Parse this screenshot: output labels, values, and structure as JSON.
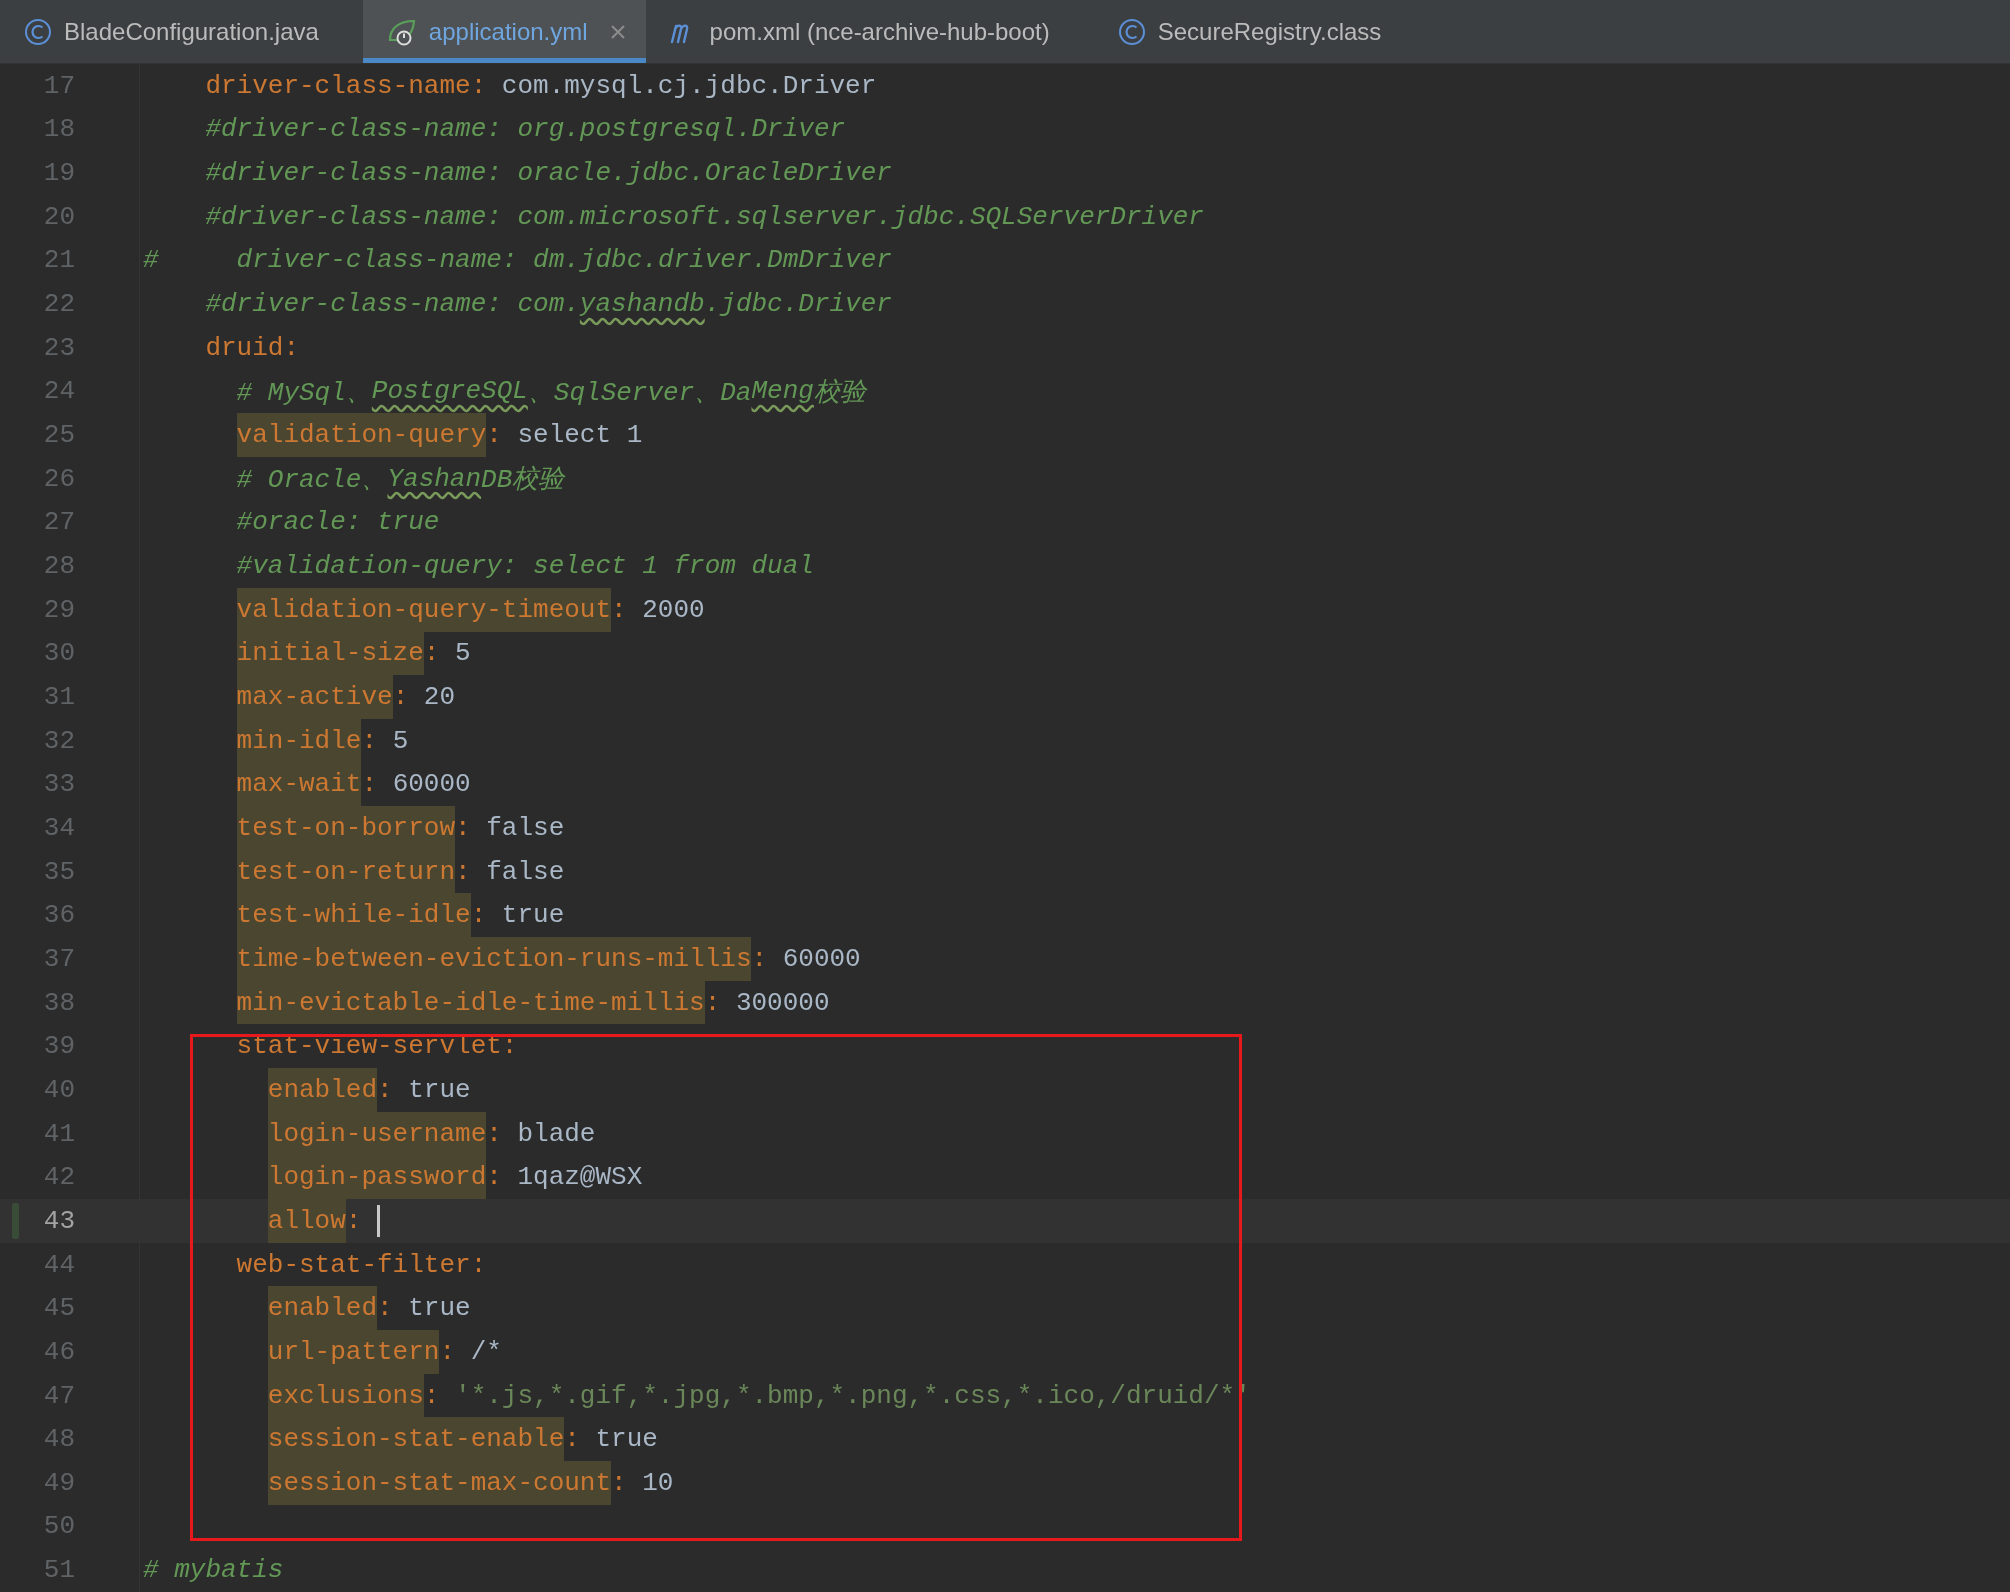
{
  "tabs": [
    {
      "label": "BladeConfiguration.java",
      "kind": "class",
      "selected": false
    },
    {
      "label": "application.yml",
      "kind": "yaml",
      "selected": true
    },
    {
      "label": "pom.xml (nce-archive-hub-boot)",
      "kind": "maven",
      "selected": false
    },
    {
      "label": "SecureRegistry.class",
      "kind": "class",
      "selected": false
    }
  ],
  "editor": {
    "lines": [
      {
        "kind": "group",
        "children": [
          {
            "kind": "group",
            "children": [
              {
                "kind": "line",
                "number": "17",
                "current": false,
                "modified": false,
                "tokens": [
                  {
                    "kind": "key",
                    "text": "driver-class-name",
                    "highlighted": false
                  },
                  {
                    "kind": "colon",
                    "text": ":"
                  },
                  {
                    "kind": "value",
                    "text": "com.mysql.cj.jdbc.Driver"
                  }
                ]
              },
              {
                "kind": "line",
                "number": "18",
                "current": false,
                "modified": false,
                "tokens": [
                  {
                    "kind": "comment",
                    "text": "#driver-class-name: org.postgresql.Driver",
                    "misspelled": false
                  }
                ]
              },
              {
                "kind": "line",
                "number": "19",
                "current": false,
                "modified": false,
                "tokens": [
                  {
                    "kind": "comment",
                    "text": "#driver-class-name: oracle.jdbc.OracleDriver",
                    "misspelled": false
                  }
                ]
              },
              {
                "kind": "line",
                "number": "20",
                "current": false,
                "modified": false,
                "tokens": [
                  {
                    "kind": "comment",
                    "text": "#driver-class-name: com.microsoft.sqlserver.jdbc.SQLServerDriver",
                    "misspelled": false
                  }
                ]
              }
            ]
          }
        ]
      },
      {
        "kind": "line",
        "number": "21",
        "current": false,
        "modified": false,
        "tokens": [
          {
            "kind": "comment",
            "text": "#     driver-class-name: dm.jdbc.driver.DmDriver",
            "misspelled": false
          }
        ]
      },
      {
        "kind": "group",
        "children": [
          {
            "kind": "group",
            "children": [
              {
                "kind": "line",
                "number": "22",
                "current": false,
                "modified": false,
                "tokens": [
                  {
                    "kind": "comment",
                    "text": "#driver-class-name: com.",
                    "misspelled": false
                  },
                  {
                    "kind": "comment",
                    "text": "yashandb",
                    "misspelled": true
                  },
                  {
                    "kind": "comment",
                    "text": ".jdbc.Driver",
                    "misspelled": false
                  }
                ]
              },
              {
                "kind": "line",
                "number": "23",
                "current": false,
                "modified": false,
                "tokens": [
                  {
                    "kind": "key",
                    "text": "druid",
                    "highlighted": false
                  },
                  {
                    "kind": "colon",
                    "text": ":"
                  }
                ],
                "children": [
                  {
                    "kind": "line",
                    "number": "24",
                    "current": false,
                    "modified": false,
                    "tokens": [
                      {
                        "kind": "comment",
                        "text": "# MySql、",
                        "misspelled": false
                      },
                      {
                        "kind": "comment",
                        "text": "PostgreSQL",
                        "misspelled": true
                      },
                      {
                        "kind": "comment",
                        "text": "、SqlServer、Da",
                        "misspelled": false
                      },
                      {
                        "kind": "comment",
                        "text": "Meng",
                        "misspelled": true
                      },
                      {
                        "kind": "comment",
                        "text": "校验",
                        "misspelled": false
                      }
                    ]
                  },
                  {
                    "kind": "line",
                    "number": "25",
                    "current": false,
                    "modified": false,
                    "tokens": [
                      {
                        "kind": "key",
                        "text": "validation-query",
                        "highlighted": true
                      },
                      {
                        "kind": "colon",
                        "text": ":"
                      },
                      {
                        "kind": "value",
                        "text": "select 1"
                      }
                    ]
                  },
                  {
                    "kind": "line",
                    "number": "26",
                    "current": false,
                    "modified": false,
                    "tokens": [
                      {
                        "kind": "comment",
                        "text": "# Oracle、",
                        "misspelled": false
                      },
                      {
                        "kind": "comment",
                        "text": "Yashan",
                        "misspelled": true
                      },
                      {
                        "kind": "comment",
                        "text": "DB校验",
                        "misspelled": false
                      }
                    ]
                  },
                  {
                    "kind": "line",
                    "number": "27",
                    "current": false,
                    "modified": false,
                    "tokens": [
                      {
                        "kind": "comment",
                        "text": "#oracle: true",
                        "misspelled": false
                      }
                    ]
                  },
                  {
                    "kind": "line",
                    "number": "28",
                    "current": false,
                    "modified": false,
                    "tokens": [
                      {
                        "kind": "comment",
                        "text": "#validation-query: select 1 from dual",
                        "misspelled": false
                      }
                    ]
                  },
                  {
                    "kind": "line",
                    "number": "29",
                    "current": false,
                    "modified": false,
                    "tokens": [
                      {
                        "kind": "key",
                        "text": "validation-query-timeout",
                        "highlighted": true
                      },
                      {
                        "kind": "colon",
                        "text": ":"
                      },
                      {
                        "kind": "value",
                        "text": "2000"
                      }
                    ]
                  },
                  {
                    "kind": "line",
                    "number": "30",
                    "current": false,
                    "modified": false,
                    "tokens": [
                      {
                        "kind": "key",
                        "text": "initial-size",
                        "highlighted": true
                      },
                      {
                        "kind": "colon",
                        "text": ":"
                      },
                      {
                        "kind": "value",
                        "text": "5"
                      }
                    ]
                  },
                  {
                    "kind": "line",
                    "number": "31",
                    "current": false,
                    "modified": false,
                    "tokens": [
                      {
                        "kind": "key",
                        "text": "max-active",
                        "highlighted": true
                      },
                      {
                        "kind": "colon",
                        "text": ":"
                      },
                      {
                        "kind": "value",
                        "text": "20"
                      }
                    ]
                  },
                  {
                    "kind": "line",
                    "number": "32",
                    "current": false,
                    "modified": false,
                    "tokens": [
                      {
                        "kind": "key",
                        "text": "min-idle",
                        "highlighted": true
                      },
                      {
                        "kind": "colon",
                        "text": ":"
                      },
                      {
                        "kind": "value",
                        "text": "5"
                      }
                    ]
                  },
                  {
                    "kind": "line",
                    "number": "33",
                    "current": false,
                    "modified": false,
                    "tokens": [
                      {
                        "kind": "key",
                        "text": "max-wait",
                        "highlighted": true
                      },
                      {
                        "kind": "colon",
                        "text": ":"
                      },
                      {
                        "kind": "value",
                        "text": "60000"
                      }
                    ]
                  },
                  {
                    "kind": "line",
                    "number": "34",
                    "current": false,
                    "modified": false,
                    "tokens": [
                      {
                        "kind": "key",
                        "text": "test-on-borrow",
                        "highlighted": true
                      },
                      {
                        "kind": "colon",
                        "text": ":"
                      },
                      {
                        "kind": "value",
                        "text": "false"
                      }
                    ]
                  },
                  {
                    "kind": "line",
                    "number": "35",
                    "current": false,
                    "modified": false,
                    "tokens": [
                      {
                        "kind": "key",
                        "text": "test-on-return",
                        "highlighted": true
                      },
                      {
                        "kind": "colon",
                        "text": ":"
                      },
                      {
                        "kind": "value",
                        "text": "false"
                      }
                    ]
                  },
                  {
                    "kind": "line",
                    "number": "36",
                    "current": false,
                    "modified": false,
                    "tokens": [
                      {
                        "kind": "key",
                        "text": "test-while-idle",
                        "highlighted": true
                      },
                      {
                        "kind": "colon",
                        "text": ":"
                      },
                      {
                        "kind": "value",
                        "text": "true"
                      }
                    ]
                  },
                  {
                    "kind": "line",
                    "number": "37",
                    "current": false,
                    "modified": false,
                    "tokens": [
                      {
                        "kind": "key",
                        "text": "time-between-eviction-runs-millis",
                        "highlighted": true
                      },
                      {
                        "kind": "colon",
                        "text": ":"
                      },
                      {
                        "kind": "value",
                        "text": "60000"
                      }
                    ]
                  },
                  {
                    "kind": "line",
                    "number": "38",
                    "current": false,
                    "modified": false,
                    "tokens": [
                      {
                        "kind": "key",
                        "text": "min-evictable-idle-time-millis",
                        "highlighted": true
                      },
                      {
                        "kind": "colon",
                        "text": ":"
                      },
                      {
                        "kind": "value",
                        "text": "300000"
                      }
                    ]
                  },
                  {
                    "kind": "annotation",
                    "children": [
                      {
                        "kind": "line",
                        "number": "39",
                        "current": false,
                        "modified": false,
                        "tokens": [
                          {
                            "kind": "key",
                            "text": "stat-view-servlet",
                            "highlighted": false
                          },
                          {
                            "kind": "colon",
                            "text": ":"
                          }
                        ],
                        "children": [
                          {
                            "kind": "line",
                            "number": "40",
                            "current": false,
                            "modified": false,
                            "tokens": [
                              {
                                "kind": "key",
                                "text": "enabled",
                                "highlighted": true
                              },
                              {
                                "kind": "colon",
                                "text": ":"
                              },
                              {
                                "kind": "value",
                                "text": "true"
                              }
                            ]
                          },
                          {
                            "kind": "line",
                            "number": "41",
                            "current": false,
                            "modified": false,
                            "tokens": [
                              {
                                "kind": "key",
                                "text": "login-username",
                                "highlighted": true
                              },
                              {
                                "kind": "colon",
                                "text": ":"
                              },
                              {
                                "kind": "value",
                                "text": "blade"
                              }
                            ]
                          },
                          {
                            "kind": "line",
                            "number": "42",
                            "current": false,
                            "modified": false,
                            "tokens": [
                              {
                                "kind": "key",
                                "text": "login-password",
                                "highlighted": true
                              },
                              {
                                "kind": "colon",
                                "text": ":"
                              },
                              {
                                "kind": "value",
                                "text": "1qaz@WSX"
                              }
                            ]
                          },
                          {
                            "kind": "line",
                            "number": "43",
                            "current": true,
                            "modified": true,
                            "tokens": [
                              {
                                "kind": "key",
                                "text": "allow",
                                "highlighted": true
                              },
                              {
                                "kind": "colon",
                                "text": ":"
                              }
                            ]
                          }
                        ]
                      },
                      {
                        "kind": "line",
                        "number": "44",
                        "current": false,
                        "modified": false,
                        "tokens": [
                          {
                            "kind": "key",
                            "text": "web-stat-filter",
                            "highlighted": false
                          },
                          {
                            "kind": "colon",
                            "text": ":"
                          }
                        ],
                        "children": [
                          {
                            "kind": "line",
                            "number": "45",
                            "current": false,
                            "modified": false,
                            "tokens": [
                              {
                                "kind": "key",
                                "text": "enabled",
                                "highlighted": true
                              },
                              {
                                "kind": "colon",
                                "text": ":"
                              },
                              {
                                "kind": "value",
                                "text": "true"
                              }
                            ]
                          },
                          {
                            "kind": "line",
                            "number": "46",
                            "current": false,
                            "modified": false,
                            "tokens": [
                              {
                                "kind": "key",
                                "text": "url-pattern",
                                "highlighted": true
                              },
                              {
                                "kind": "colon",
                                "text": ":"
                              },
                              {
                                "kind": "value",
                                "text": "/*"
                              }
                            ]
                          },
                          {
                            "kind": "line",
                            "number": "47",
                            "current": false,
                            "modified": false,
                            "tokens": [
                              {
                                "kind": "key",
                                "text": "exclusions",
                                "highlighted": true
                              },
                              {
                                "kind": "colon",
                                "text": ":"
                              },
                              {
                                "kind": "string",
                                "text": "'*.js,*.gif,*.jpg,*.bmp,*.png,*.css,*.ico,/druid/*'"
                              }
                            ]
                          },
                          {
                            "kind": "line",
                            "number": "48",
                            "current": false,
                            "modified": false,
                            "tokens": [
                              {
                                "kind": "key",
                                "text": "session-stat-enable",
                                "highlighted": true
                              },
                              {
                                "kind": "colon",
                                "text": ":"
                              },
                              {
                                "kind": "value",
                                "text": "true"
                              }
                            ]
                          },
                          {
                            "kind": "line",
                            "number": "49",
                            "current": false,
                            "modified": false,
                            "tokens": [
                              {
                                "kind": "key",
                                "text": "session-stat-max-count",
                                "highlighted": true
                              },
                              {
                                "kind": "colon",
                                "text": ":"
                              },
                              {
                                "kind": "value",
                                "text": "10"
                              }
                            ]
                          }
                        ]
                      },
                      {
                        "kind": "line",
                        "number": "50",
                        "current": false,
                        "modified": false
                      }
                    ]
                  }
                ]
              }
            ]
          }
        ]
      },
      {
        "kind": "line",
        "number": "51",
        "current": false,
        "modified": false,
        "tokens": [
          {
            "kind": "comment",
            "text": "# mybatis",
            "misspelled": false
          }
        ]
      }
    ]
  }
}
